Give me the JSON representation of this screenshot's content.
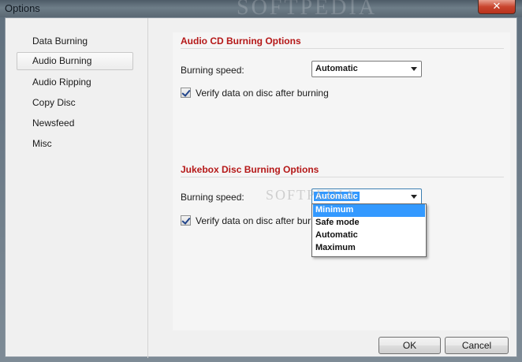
{
  "window": {
    "title": "Options",
    "watermark": "SOFTPEDIA"
  },
  "sidebar": {
    "items": [
      {
        "label": "Data Burning"
      },
      {
        "label": "Audio Burning"
      },
      {
        "label": "Audio Ripping"
      },
      {
        "label": "Copy Disc"
      },
      {
        "label": "Newsfeed"
      },
      {
        "label": "Misc"
      }
    ],
    "selected": "Audio Burning"
  },
  "audio_cd": {
    "title": "Audio CD Burning Options",
    "speed_label": "Burning speed:",
    "speed_value": "Automatic",
    "verify_label": "Verify data on disc after burning",
    "verify_checked": true
  },
  "jukebox": {
    "title": "Jukebox Disc Burning Options",
    "speed_label": "Burning speed:",
    "speed_value": "Automatic",
    "verify_label": "Verify data on disc after burning",
    "verify_checked": true,
    "speed_options": [
      "Minimum",
      "Safe mode",
      "Automatic",
      "Maximum"
    ],
    "highlighted_option": "Minimum"
  },
  "buttons": {
    "ok": "OK",
    "cancel": "Cancel"
  },
  "colors": {
    "section_title": "#b51818",
    "selection": "#3399ff"
  }
}
